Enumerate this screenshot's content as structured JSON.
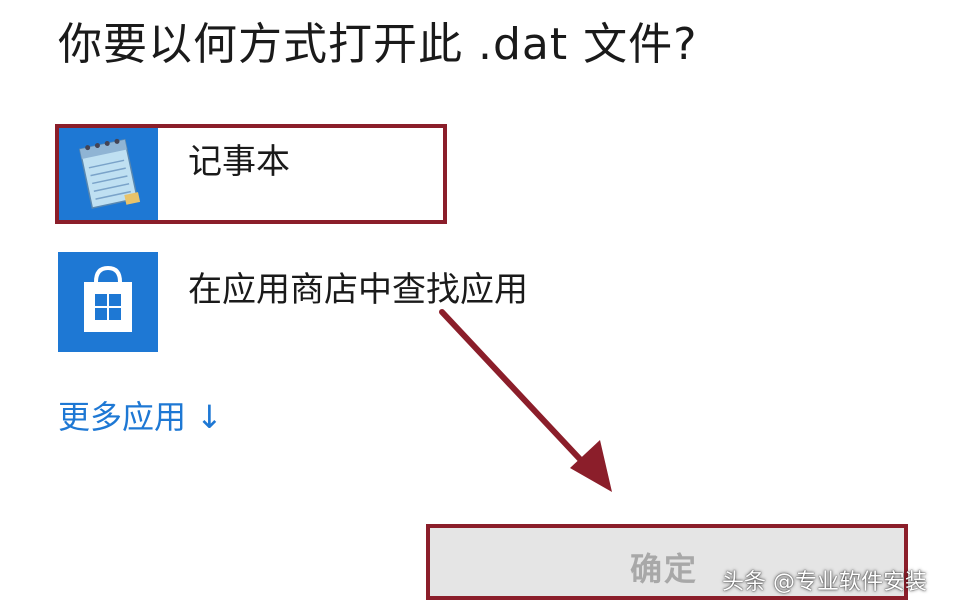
{
  "dialog": {
    "title": "你要以何方式打开此 .dat 文件?"
  },
  "apps": [
    {
      "label": "记事本",
      "icon": "notepad-icon",
      "selected": true
    },
    {
      "label": "在应用商店中查找应用",
      "icon": "store-icon",
      "selected": false
    }
  ],
  "more_apps": {
    "label": "更多应用",
    "arrow": "↓"
  },
  "ok_button": {
    "label": "确定",
    "enabled": false
  },
  "watermark": {
    "text": "头条 @专业软件安装"
  },
  "colors": {
    "accent": "#1e78d4",
    "highlight": "#8b1e2a",
    "button_bg": "#e5e5e5",
    "button_text_disabled": "#a8a8a8"
  }
}
